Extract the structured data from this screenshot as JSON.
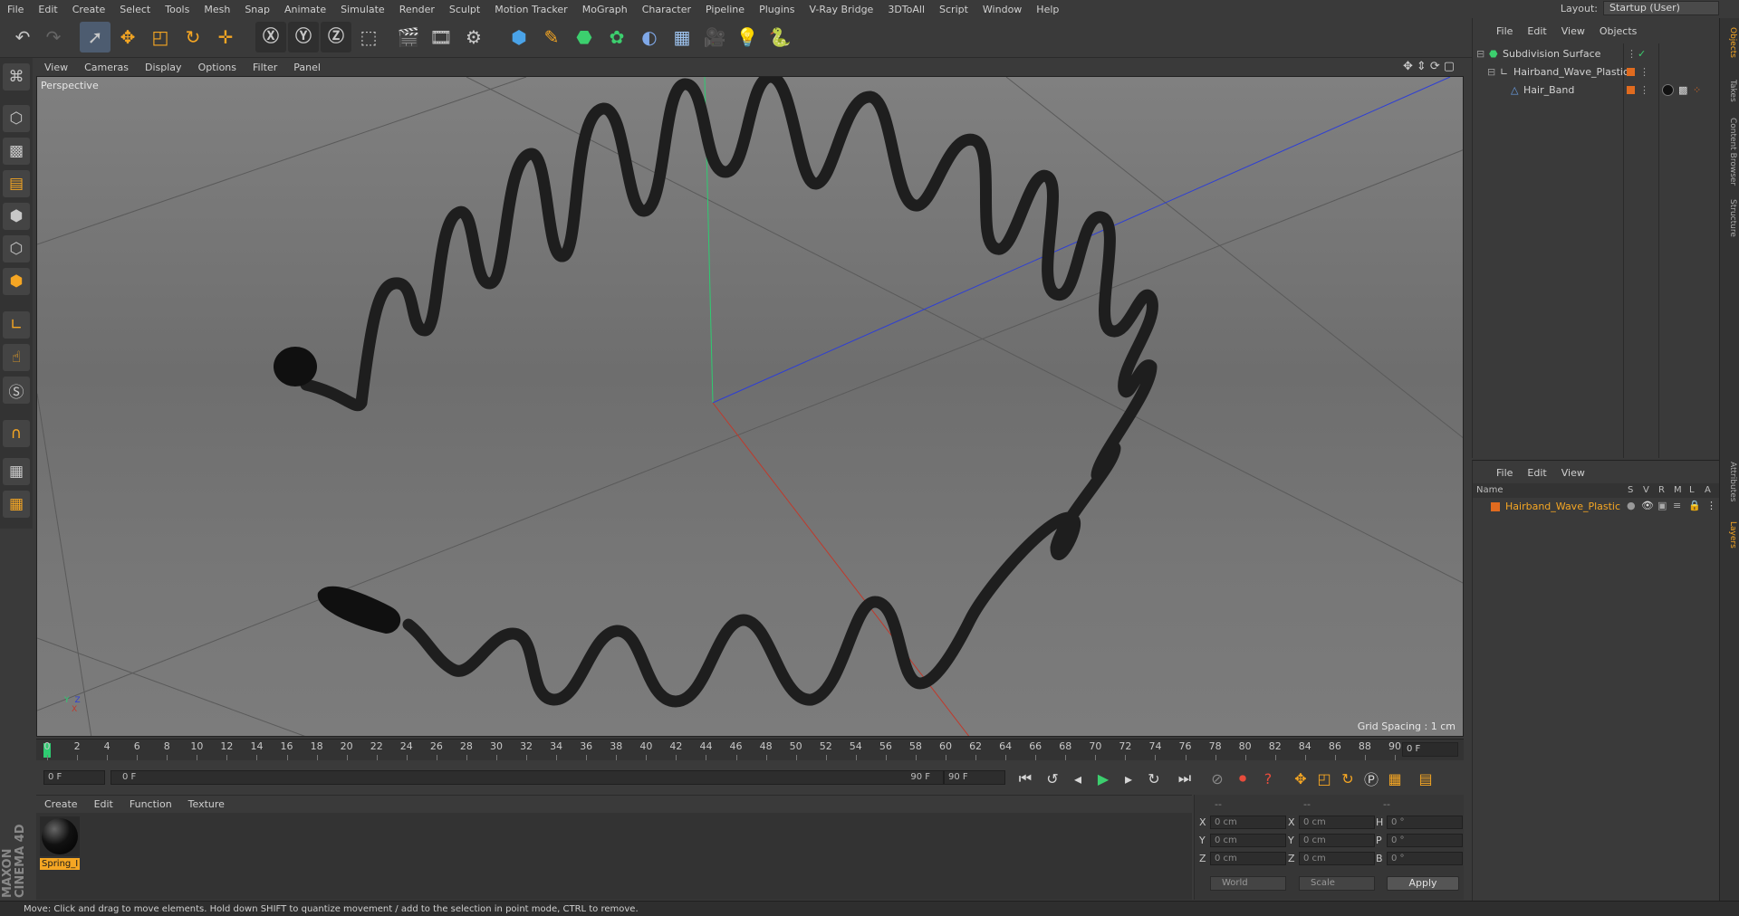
{
  "menubar": {
    "items": [
      "File",
      "Edit",
      "Create",
      "Select",
      "Tools",
      "Mesh",
      "Snap",
      "Animate",
      "Simulate",
      "Render",
      "Sculpt",
      "Motion Tracker",
      "MoGraph",
      "Character",
      "Pipeline",
      "Plugins",
      "V-Ray Bridge",
      "3DToAll",
      "Script",
      "Window",
      "Help"
    ],
    "layout_label": "Layout:",
    "layout_value": "Startup (User)"
  },
  "viewport": {
    "menu": [
      "View",
      "Cameras",
      "Display",
      "Options",
      "Filter",
      "Panel"
    ],
    "camera_label": "Perspective",
    "grid_spacing": "Grid Spacing : 1 cm"
  },
  "timeline": {
    "ticks": [
      "0",
      "2",
      "4",
      "6",
      "8",
      "10",
      "12",
      "14",
      "16",
      "18",
      "20",
      "22",
      "24",
      "26",
      "28",
      "30",
      "32",
      "34",
      "36",
      "38",
      "40",
      "42",
      "44",
      "46",
      "48",
      "50",
      "52",
      "54",
      "56",
      "58",
      "60",
      "62",
      "64",
      "66",
      "68",
      "70",
      "72",
      "74",
      "76",
      "78",
      "80",
      "82",
      "84",
      "86",
      "88",
      "90"
    ],
    "current_frame": "0 F"
  },
  "playback": {
    "start_field": "0 F",
    "range_start": "0 F",
    "range_end": "90 F",
    "end_field": "90 F"
  },
  "material_manager": {
    "menu": [
      "Create",
      "Edit",
      "Function",
      "Texture"
    ],
    "materials": [
      {
        "name": "Spring_I"
      }
    ]
  },
  "coordinates": {
    "header": [
      "--",
      "--",
      "--"
    ],
    "rows": [
      {
        "axis": "X",
        "pos": "0 cm",
        "axis2": "X",
        "size": "0 cm",
        "rot_label": "H",
        "rot": "0 °"
      },
      {
        "axis": "Y",
        "pos": "0 cm",
        "axis2": "Y",
        "size": "0 cm",
        "rot_label": "P",
        "rot": "0 °"
      },
      {
        "axis": "Z",
        "pos": "0 cm",
        "axis2": "Z",
        "size": "0 cm",
        "rot_label": "B",
        "rot": "0 °"
      }
    ],
    "coord_system": "World",
    "mode": "Scale",
    "apply_label": "Apply"
  },
  "object_manager": {
    "menu": [
      "File",
      "Edit",
      "View",
      "Objects"
    ],
    "objects": [
      {
        "name": "Subdivision Surface",
        "indent": 0
      },
      {
        "name": "Hairband_Wave_Plastic",
        "indent": 1
      },
      {
        "name": "Hair_Band",
        "indent": 2
      }
    ]
  },
  "layer_manager": {
    "menu": [
      "File",
      "Edit",
      "View"
    ],
    "columns": [
      "Name",
      "S",
      "V",
      "R",
      "M",
      "L",
      "A"
    ],
    "layers": [
      {
        "name": "Hairband_Wave_Plastic",
        "color": "#e06b1f"
      }
    ]
  },
  "right_tabs": [
    "Objects",
    "Takes",
    "Content Browser",
    "Structure",
    "Attributes",
    "Layers"
  ],
  "statusbar": {
    "text": "Move: Click and drag to move elements. Hold down SHIFT to quantize movement / add to the selection in point mode, CTRL to remove."
  },
  "logo": {
    "text": "MAXON CINEMA 4D"
  },
  "colors": {
    "accent": "#f5a623",
    "axis_x": "#c0392b",
    "axis_y": "#2ecc71",
    "axis_z": "#2d3ed6",
    "layer_color": "#e06b1f"
  }
}
